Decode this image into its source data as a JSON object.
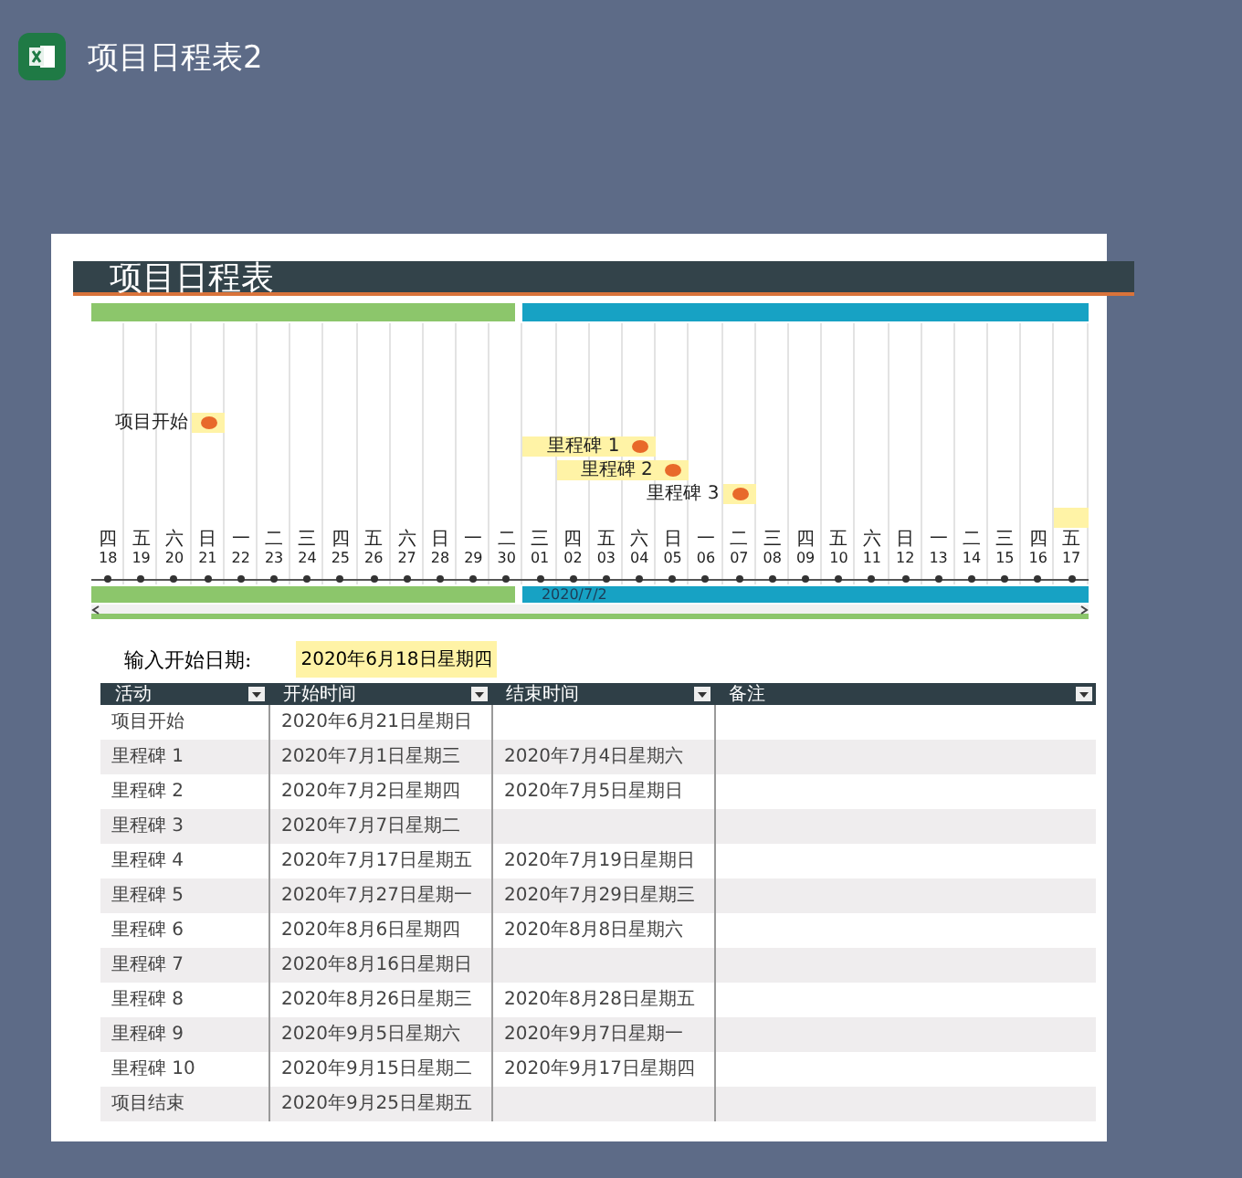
{
  "app": {
    "title": "项目日程表2"
  },
  "sheet": {
    "title": "项目日程表"
  },
  "timeline": {
    "periods": [
      {
        "color": "#8cc66b",
        "days": [
          {
            "weekday": "四",
            "date": "18"
          },
          {
            "weekday": "五",
            "date": "19"
          },
          {
            "weekday": "六",
            "date": "20"
          },
          {
            "weekday": "日",
            "date": "21"
          },
          {
            "weekday": "一",
            "date": "22"
          },
          {
            "weekday": "二",
            "date": "23"
          },
          {
            "weekday": "三",
            "date": "24"
          },
          {
            "weekday": "四",
            "date": "25"
          },
          {
            "weekday": "五",
            "date": "26"
          },
          {
            "weekday": "六",
            "date": "27"
          },
          {
            "weekday": "日",
            "date": "28"
          },
          {
            "weekday": "一",
            "date": "29"
          },
          {
            "weekday": "二",
            "date": "30"
          }
        ]
      },
      {
        "color": "#17a2c4",
        "label": "2020/7/2",
        "days": [
          {
            "weekday": "三",
            "date": "01"
          },
          {
            "weekday": "四",
            "date": "02"
          },
          {
            "weekday": "五",
            "date": "03"
          },
          {
            "weekday": "六",
            "date": "04"
          },
          {
            "weekday": "日",
            "date": "05"
          },
          {
            "weekday": "一",
            "date": "06"
          },
          {
            "weekday": "二",
            "date": "07"
          },
          {
            "weekday": "三",
            "date": "08"
          },
          {
            "weekday": "四",
            "date": "09"
          },
          {
            "weekday": "五",
            "date": "10"
          },
          {
            "weekday": "六",
            "date": "11"
          },
          {
            "weekday": "日",
            "date": "12"
          },
          {
            "weekday": "一",
            "date": "13"
          },
          {
            "weekday": "二",
            "date": "14"
          },
          {
            "weekday": "三",
            "date": "15"
          },
          {
            "weekday": "四",
            "date": "16"
          },
          {
            "weekday": "五",
            "date": "17"
          }
        ]
      }
    ],
    "milestone_labels": [
      "项目开始",
      "里程碑 1",
      "里程碑 2",
      "里程碑 3"
    ]
  },
  "start_date": {
    "label": "输入开始日期:",
    "value": "2020年6月18日星期四"
  },
  "table": {
    "columns": [
      "活动",
      "开始时间",
      "结束时间",
      "备注"
    ],
    "rows": [
      [
        "项目开始",
        "2020年6月21日星期日",
        ""
      ],
      [
        "里程碑 1",
        "2020年7月1日星期三",
        "2020年7月4日星期六"
      ],
      [
        "里程碑 2",
        "2020年7月2日星期四",
        "2020年7月5日星期日"
      ],
      [
        "里程碑 3",
        "2020年7月7日星期二",
        ""
      ],
      [
        "里程碑 4",
        "2020年7月17日星期五",
        "2020年7月19日星期日"
      ],
      [
        "里程碑 5",
        "2020年7月27日星期一",
        "2020年7月29日星期三"
      ],
      [
        "里程碑 6",
        "2020年8月6日星期四",
        "2020年8月8日星期六"
      ],
      [
        "里程碑 7",
        "2020年8月16日星期日",
        ""
      ],
      [
        "里程碑 8",
        "2020年8月26日星期三",
        "2020年8月28日星期五"
      ],
      [
        "里程碑 9",
        "2020年9月5日星期六",
        "2020年9月7日星期一"
      ],
      [
        "里程碑 10",
        "2020年9月15日星期二",
        "2020年9月17日星期四"
      ],
      [
        "项目结束",
        "2020年9月25日星期五",
        ""
      ]
    ]
  }
}
